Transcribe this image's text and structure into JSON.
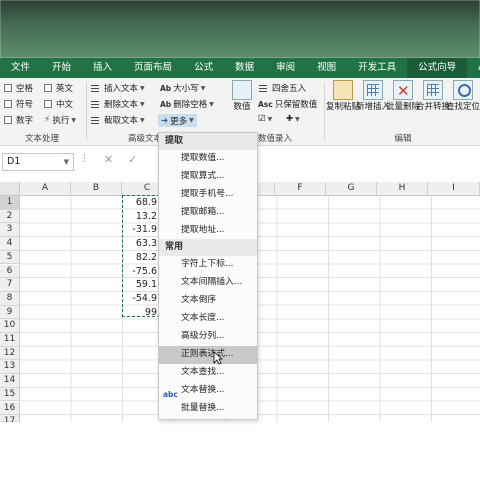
{
  "tabs": [
    "文件",
    "开始",
    "插入",
    "页面布局",
    "公式",
    "数据",
    "审阅",
    "视图",
    "开发工具",
    "公式向导",
    "Acrobat"
  ],
  "ribbon": {
    "text_group": {
      "label": "文本处理",
      "checkboxes": [
        "空格",
        "符号",
        "数字",
        "英文",
        "中文"
      ],
      "exec_label": "执行",
      "insert_text": "插入文本",
      "delete_text": "删除文本",
      "extract_text": "截取文本",
      "case_label": "大小写",
      "delete_space": "删除空格",
      "more_label": "更多"
    },
    "advanced_label": "高级文本",
    "num_group": {
      "label": "数值录入",
      "value_btn": "数值",
      "round_btn": "四舍五入",
      "keep_btn": "只保留数值"
    },
    "edit_group": {
      "label": "编辑",
      "buttons": [
        "复制粘贴",
        "新增插入",
        "批量删除",
        "合并转换",
        "查找定位"
      ]
    }
  },
  "formula_bar": {
    "name_box": "D1"
  },
  "columns": [
    "A",
    "B",
    "C",
    "D",
    "E",
    "F",
    "G",
    "H",
    "I"
  ],
  "rows": [
    "1",
    "2",
    "3",
    "4",
    "5",
    "6",
    "7",
    "8",
    "9",
    "10",
    "11",
    "12",
    "13",
    "14",
    "15",
    "16",
    "17"
  ],
  "column_c_values": [
    "68.9",
    "13.2",
    "-31.9",
    "63.3",
    "82.2",
    "-75.6",
    "59.1",
    "-54.9",
    "99"
  ],
  "dropdown": {
    "section_extract": "提取",
    "extract_items": [
      "提取数值...",
      "提取算式...",
      "提取手机号...",
      "提取邮箱...",
      "提取地址..."
    ],
    "section_common": "常用",
    "common_items": [
      "字符上下标...",
      "文本间隔插入...",
      "文本倒序",
      "文本长度...",
      "高级分列...",
      "正则表达式...",
      "文本查找...",
      "文本替换...",
      "批量替换..."
    ],
    "highlighted_item": "正则表达式..."
  },
  "colors": {
    "accent": "#217346",
    "tab_active": "#1a5c37"
  }
}
